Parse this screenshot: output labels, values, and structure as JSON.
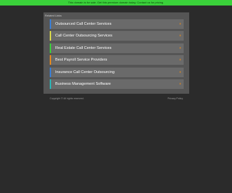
{
  "topbar": {
    "text": "This domain is for sale. Get this premium domain today. Contact us for pricing."
  },
  "panel": {
    "label": "Related Links"
  },
  "links": [
    {
      "label": "Outsourced Call Center Services",
      "arrow": "»",
      "color": "#3a7fd6"
    },
    {
      "label": "Call Center Outsourcing Services",
      "arrow": "»",
      "color": "#d9d94a"
    },
    {
      "label": "Real Estate Call Center Services",
      "arrow": "»",
      "color": "#3ad13a"
    },
    {
      "label": "Best Payroll Service Providers",
      "arrow": "»",
      "color": "#e68a1e"
    },
    {
      "label": "Insurance Call Center Outsourcing",
      "arrow": "»",
      "color": "#3a7fd6"
    },
    {
      "label": "Business Management Software",
      "arrow": "»",
      "color": "#2bb5b5"
    }
  ],
  "footer": {
    "copyright": "Copyright © All rights reserved.",
    "privacy": "Privacy Policy"
  }
}
